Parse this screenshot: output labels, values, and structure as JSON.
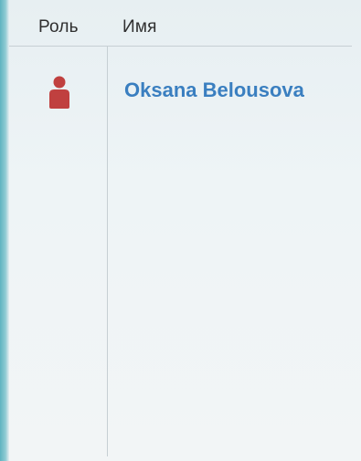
{
  "table": {
    "headers": {
      "role": "Роль",
      "name": "Имя"
    },
    "rows": [
      {
        "role_icon": "user-icon",
        "role_icon_color": "#c0403f",
        "name": "Oksana Belousova",
        "name_color": "#3a7fc0"
      }
    ]
  }
}
